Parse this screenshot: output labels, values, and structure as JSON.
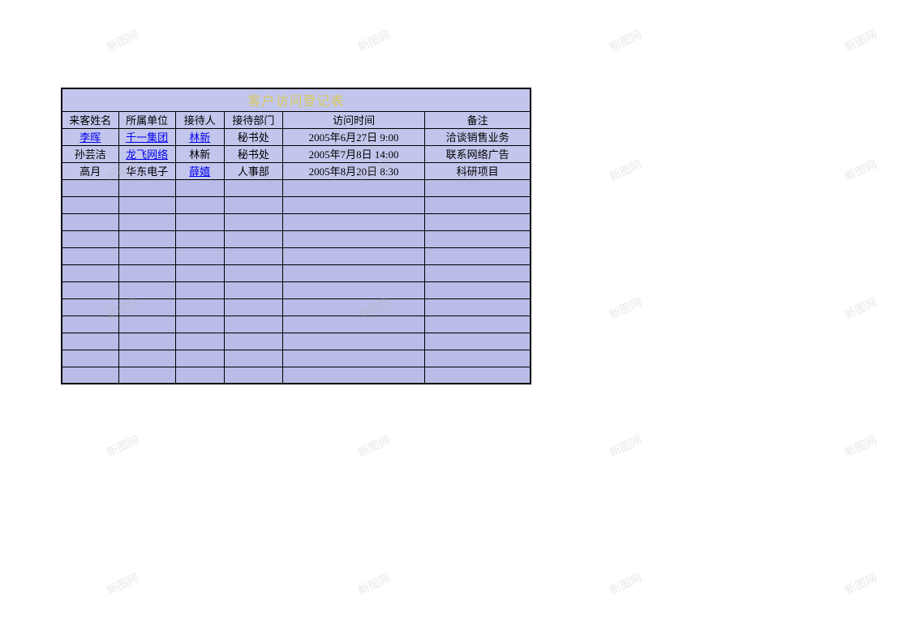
{
  "title": "客户访问登记表",
  "headers": {
    "visitor_name": "来客姓名",
    "company": "所属单位",
    "receiver": "接待人",
    "department": "接待部门",
    "visit_time": "访问时间",
    "notes": "备注"
  },
  "rows": [
    {
      "visitor_name": "李晖",
      "visitor_name_link": true,
      "company": "千一集团",
      "company_link": true,
      "receiver": "林新",
      "receiver_link": true,
      "department": "秘书处",
      "visit_time": "2005年6月27日 9:00",
      "notes": "洽谈销售业务"
    },
    {
      "visitor_name": "孙芸洁",
      "visitor_name_link": false,
      "company": "龙飞网络",
      "company_link": true,
      "receiver": "林新",
      "receiver_link": false,
      "department": "秘书处",
      "visit_time": "2005年7月8日 14:00",
      "notes": "联系网络广告"
    },
    {
      "visitor_name": "高月",
      "visitor_name_link": false,
      "company": "华东电子",
      "company_link": false,
      "receiver": "薛嬉",
      "receiver_link": true,
      "department": "人事部",
      "visit_time": "2005年8月20日 8:30",
      "notes": "科研项目"
    }
  ],
  "empty_rows_count": 12,
  "watermark_text": "新图网"
}
